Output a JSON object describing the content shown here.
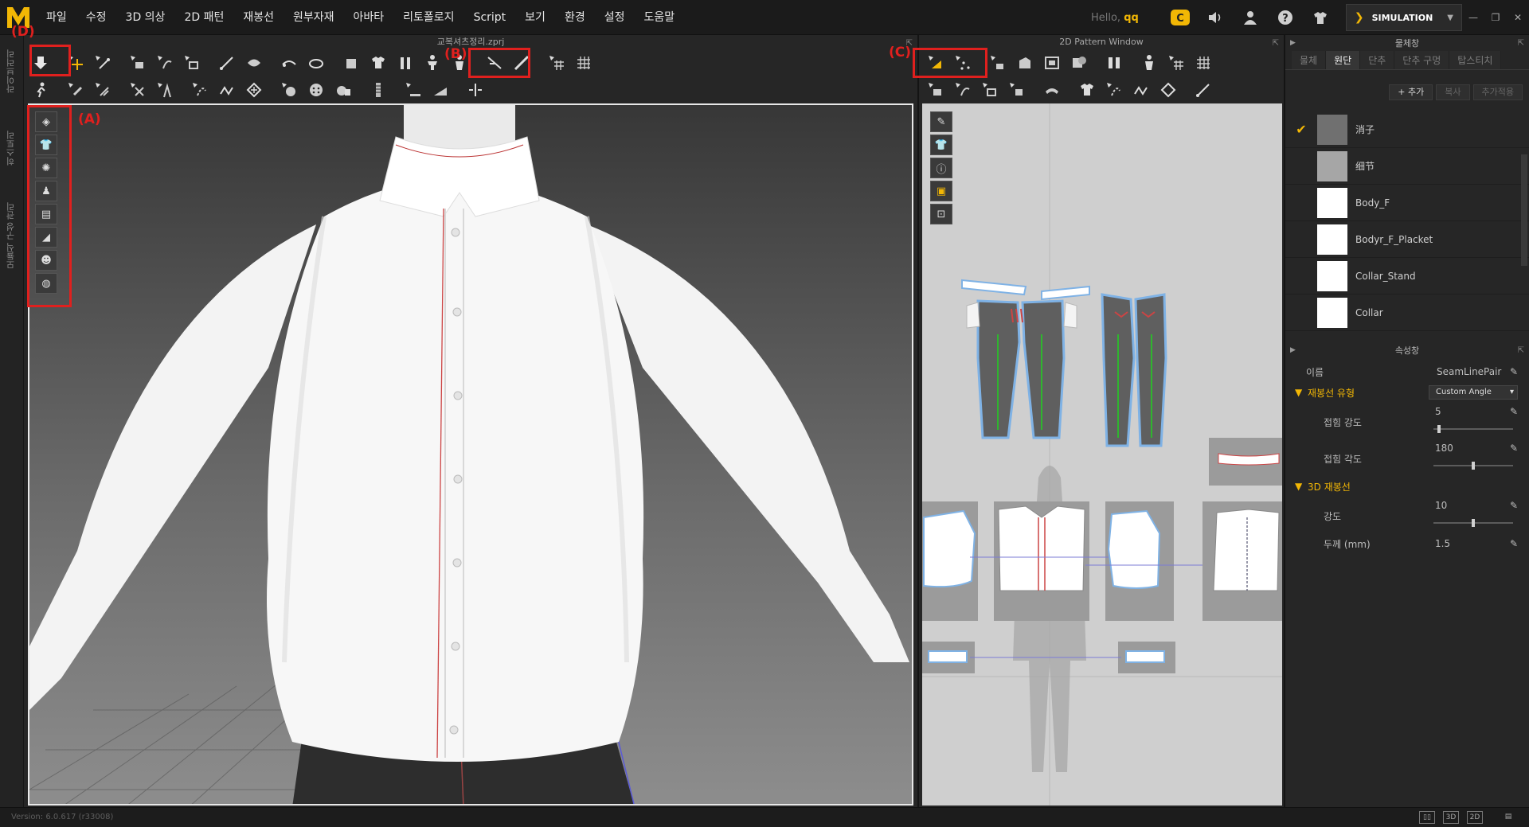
{
  "menu": [
    "파일",
    "수정",
    "3D 의상",
    "2D 패턴",
    "재봉선",
    "원부자재",
    "아바타",
    "리토폴로지",
    "Script",
    "보기",
    "환경",
    "설정",
    "도움말"
  ],
  "user": {
    "hello": "Hello,",
    "name": "qq"
  },
  "simulation": {
    "label": "SIMULATION"
  },
  "side_tabs": [
    "라이브러리",
    "히스토리",
    "모듈식 구성 관리"
  ],
  "window3d": {
    "title": "교복셔츠정리.zprj"
  },
  "window2d": {
    "title": "2D Pattern Window"
  },
  "annotations": {
    "a": "(A)",
    "b": "(B)",
    "c": "(C)",
    "d": "(D)"
  },
  "object_panel": {
    "title": "물체창",
    "tabs": [
      "물체",
      "원단",
      "단추",
      "단추 구멍",
      "탑스티치"
    ],
    "active_tab": "원단",
    "actions": {
      "add": "+ 추가",
      "copy": "복사",
      "apply": "추가적용"
    },
    "materials": [
      {
        "name": "消子",
        "color": "#707070",
        "checked": true
      },
      {
        "name": "细节",
        "color": "#a6a6a6",
        "checked": false
      },
      {
        "name": "Body_F",
        "color": "#ffffff",
        "checked": false
      },
      {
        "name": "Bodyr_F_Placket",
        "color": "#ffffff",
        "checked": false
      },
      {
        "name": "Collar_Stand",
        "color": "#ffffff",
        "checked": false
      },
      {
        "name": "Collar",
        "color": "#ffffff",
        "checked": false
      }
    ]
  },
  "property_panel": {
    "title": "속성창",
    "name_label": "이름",
    "name_value": "SeamLinePair",
    "sewing_type": {
      "label": "재봉선 유형",
      "value": "Custom Angle"
    },
    "fold_strength": {
      "label": "접힘 강도",
      "value": "5",
      "fraction": 0.05
    },
    "fold_angle": {
      "label": "접힘 각도",
      "value": "180",
      "fraction": 0.5
    },
    "seam3d": {
      "label": "3D 재봉선"
    },
    "strength": {
      "label": "강도",
      "value": "10",
      "fraction": 0.5
    },
    "thickness": {
      "label": "두께 (mm)",
      "value": "1.5"
    }
  },
  "status": {
    "version": "Version: 6.0.617 (r33008)",
    "view_3d": "3D",
    "view_2d": "2D"
  }
}
